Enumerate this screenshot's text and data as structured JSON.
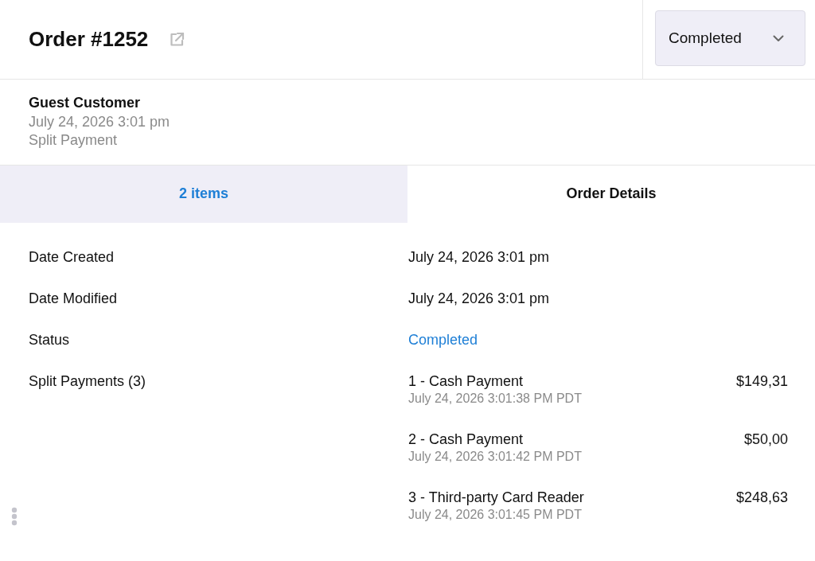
{
  "header": {
    "title": "Order #1252",
    "status_select": {
      "value": "Completed"
    }
  },
  "customer": {
    "name": "Guest Customer",
    "date": "July 24, 2026 3:01 pm",
    "payment_method": "Split Payment"
  },
  "tabs": [
    {
      "label": "2 items",
      "selected": false
    },
    {
      "label": "Order Details",
      "selected": true
    }
  ],
  "details": [
    {
      "kind": "text",
      "label": "Date Created",
      "value": "July 24, 2026 3:01 pm"
    },
    {
      "kind": "text",
      "label": "Date Modified",
      "value": "July 24, 2026 3:01 pm"
    },
    {
      "kind": "status",
      "label": "Status",
      "value": "Completed"
    },
    {
      "kind": "payments",
      "label": "Split Payments (3)",
      "payments": [
        {
          "name": "1 - Cash Payment",
          "time": "July 24, 2026 3:01:38 PM PDT",
          "amount": "$149,31"
        },
        {
          "name": "2 - Cash Payment",
          "time": "July 24, 2026 3:01:42 PM PDT",
          "amount": "$50,00"
        },
        {
          "name": "3 - Third-party Card Reader",
          "time": "July 24, 2026 3:01:45 PM PDT",
          "amount": "$248,63"
        }
      ]
    }
  ]
}
